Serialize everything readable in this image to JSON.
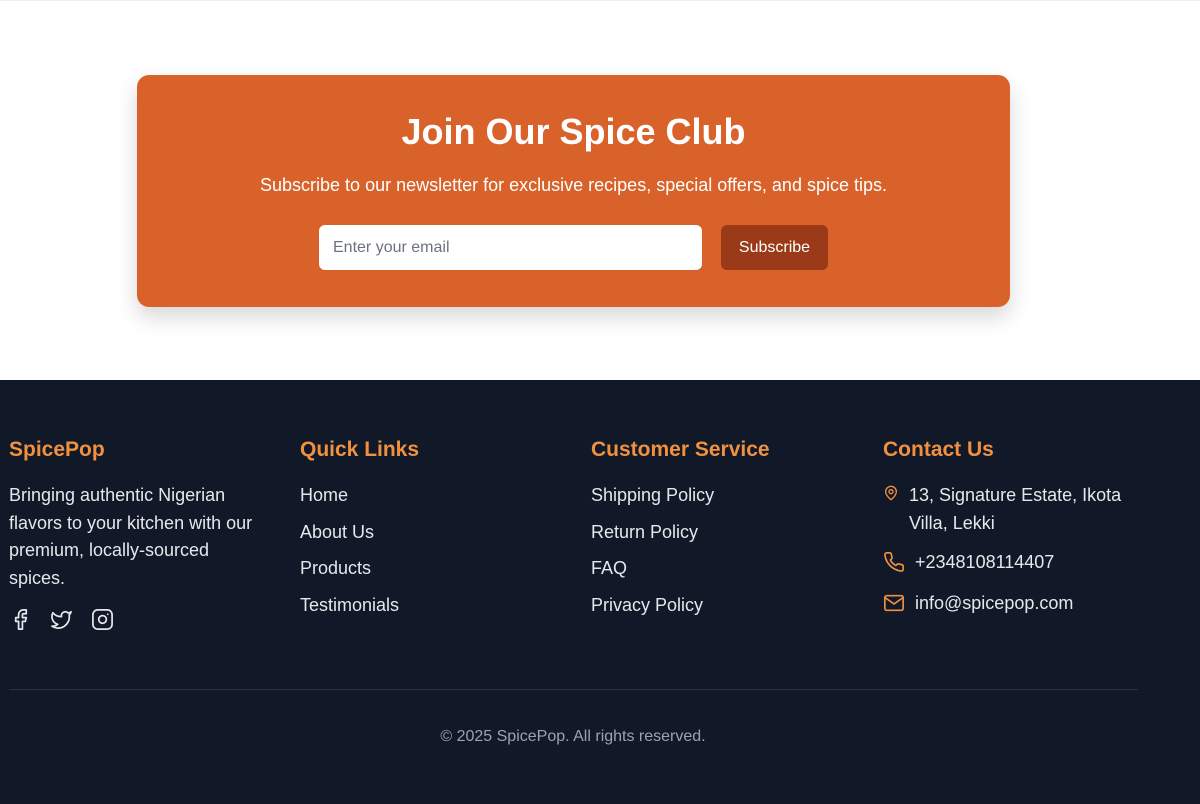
{
  "newsletter": {
    "title": "Join Our Spice Club",
    "subtitle": "Subscribe to our newsletter for exclusive recipes, special offers, and spice tips.",
    "email_placeholder": "Enter your email",
    "subscribe_label": "Subscribe",
    "accent_color": "#d9622b",
    "button_color": "#9a3a18"
  },
  "footer": {
    "background_color": "#111827",
    "heading_color": "#f0913f",
    "brand": {
      "name": "SpicePop",
      "description": "Bringing authentic Nigerian flavors to your kitchen with our premium, locally-sourced spices.",
      "socials": [
        "facebook-icon",
        "twitter-icon",
        "instagram-icon"
      ]
    },
    "quick_links": {
      "heading": "Quick Links",
      "items": [
        "Home",
        "About Us",
        "Products",
        "Testimonials"
      ]
    },
    "customer_service": {
      "heading": "Customer Service",
      "items": [
        "Shipping Policy",
        "Return Policy",
        "FAQ",
        "Privacy Policy"
      ]
    },
    "contact": {
      "heading": "Contact Us",
      "address": "13, Signature Estate, Ikota Villa, Lekki",
      "phone": "+2348108114407",
      "email": "info@spicepop.com"
    },
    "copyright": "© 2025 SpicePop. All rights reserved."
  }
}
